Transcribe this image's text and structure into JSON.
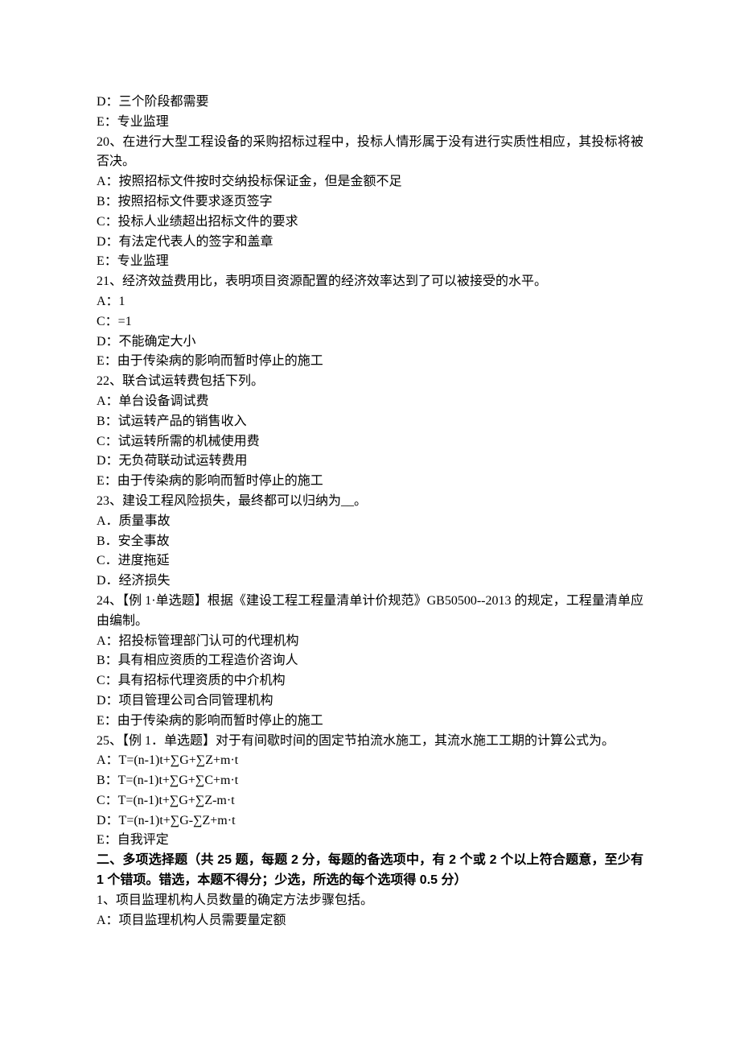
{
  "lines": [
    {
      "text": "D：三个阶段都需要",
      "bold": false
    },
    {
      "text": "E：专业监理",
      "bold": false
    },
    {
      "text": "20、在进行大型工程设备的采购招标过程中，投标人情形属于没有进行实质性相应，其投标将被否决。",
      "bold": false,
      "justify": true
    },
    {
      "text": "A：按照招标文件按时交纳投标保证金，但是金额不足",
      "bold": false
    },
    {
      "text": "B：按照招标文件要求逐页签字",
      "bold": false
    },
    {
      "text": "C：投标人业绩超出招标文件的要求",
      "bold": false
    },
    {
      "text": "D：有法定代表人的签字和盖章",
      "bold": false
    },
    {
      "text": "E：专业监理",
      "bold": false
    },
    {
      "text": "21、经济效益费用比，表明项目资源配置的经济效率达到了可以被接受的水平。",
      "bold": false
    },
    {
      "text": "A：1",
      "bold": false
    },
    {
      "text": "C：=1",
      "bold": false
    },
    {
      "text": "D：不能确定大小",
      "bold": false
    },
    {
      "text": "E：由于传染病的影响而暂时停止的施工",
      "bold": false
    },
    {
      "text": "22、联合试运转费包括下列。",
      "bold": false
    },
    {
      "text": "A：单台设备调试费",
      "bold": false
    },
    {
      "text": "B：试运转产品的销售收入",
      "bold": false
    },
    {
      "text": "C：试运转所需的机械使用费",
      "bold": false
    },
    {
      "text": "D：无负荷联动试运转费用",
      "bold": false
    },
    {
      "text": "E：由于传染病的影响而暂时停止的施工",
      "bold": false
    },
    {
      "text": "23、建设工程风险损失，最终都可以归纳为__。",
      "bold": false
    },
    {
      "text": "A．质量事故",
      "bold": false
    },
    {
      "text": "B．安全事故",
      "bold": false
    },
    {
      "text": "C．进度拖延",
      "bold": false
    },
    {
      "text": "D．经济损失",
      "bold": false
    },
    {
      "text": "24、【例 1·单选题】根据《建设工程工程量清单计价规范》GB50500--2013 的规定，工程量清单应由编制。",
      "bold": false,
      "justify": true
    },
    {
      "text": "A：招投标管理部门认可的代理机构",
      "bold": false
    },
    {
      "text": "B：具有相应资质的工程造价咨询人",
      "bold": false
    },
    {
      "text": "C：具有招标代理资质的中介机构",
      "bold": false
    },
    {
      "text": "D：项目管理公司合同管理机构",
      "bold": false
    },
    {
      "text": "E：由于传染病的影响而暂时停止的施工",
      "bold": false
    },
    {
      "text": "25、【例 1．单选题】对于有间歇时间的固定节拍流水施工，其流水施工工期的计算公式为。",
      "bold": false,
      "justify": true
    },
    {
      "text": "A：T=(n-1)t+∑G+∑Z+m·t",
      "bold": false
    },
    {
      "text": "B：T=(n-1)t+∑G+∑C+m·t",
      "bold": false
    },
    {
      "text": "C：T=(n-1)t+∑G+∑Z-m·t",
      "bold": false
    },
    {
      "text": "D：T=(n-1)t+∑G-∑Z+m·t",
      "bold": false
    },
    {
      "text": "E：自我评定",
      "bold": false
    },
    {
      "text": "二、多项选择题（共 25 题，每题 2 分，每题的备选项中，有 2 个或 2 个以上符合题意，至少有 1 个错项。错选，本题不得分；少选，所选的每个选项得 0.5 分）",
      "bold": true,
      "justify": true
    },
    {
      "text": "1、项目监理机构人员数量的确定方法步骤包括。",
      "bold": false
    },
    {
      "text": "A：项目监理机构人员需要量定额",
      "bold": false
    }
  ]
}
